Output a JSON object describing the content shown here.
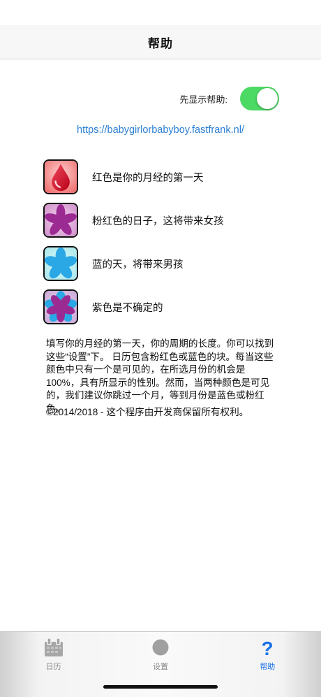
{
  "nav": {
    "title": "帮助"
  },
  "toggle": {
    "label": "先显示帮助:",
    "on": true
  },
  "link": {
    "text": "https://babygirlorbabyboy.fastfrank.nl/"
  },
  "legend": [
    {
      "text": "红色是你的月经的第一天",
      "icon": "red-drop-icon"
    },
    {
      "text": "粉红色的日子，这将带来女孩",
      "icon": "pink-flower-icon"
    },
    {
      "text": "蓝的天，将带来男孩",
      "icon": "blue-flower-icon"
    },
    {
      "text": "紫色是不确定的",
      "icon": "purple-flower-icon"
    }
  ],
  "description": "填写你的月经的第一天，你的周期的长度。你可以找到这些“设置”下。 日历包含粉红色或蓝色的块。每当这些颜色中只有一个是可见的，在所选月份的机会是100%，具有所显示的性别。然而，当两种颜色是可见的，我们建议你跳过一个月，等到月份是蓝色或粉红色。",
  "copyright": "©2014/2018 - 这个程序由开发商保留所有权利。",
  "tabs": [
    {
      "label": "日历",
      "icon": "calendar-icon",
      "active": false
    },
    {
      "label": "设置",
      "icon": "circle-icon",
      "active": false
    },
    {
      "label": "帮助",
      "icon": "question-icon",
      "active": true
    }
  ],
  "colors": {
    "toggle_on": "#4cd964",
    "link": "#2a7fd4",
    "active_tab": "#1a73e8",
    "inactive_tab": "#8a8a8a",
    "red": "#d0102a",
    "pink": "#9b2a93",
    "blue": "#2aa8e6"
  }
}
